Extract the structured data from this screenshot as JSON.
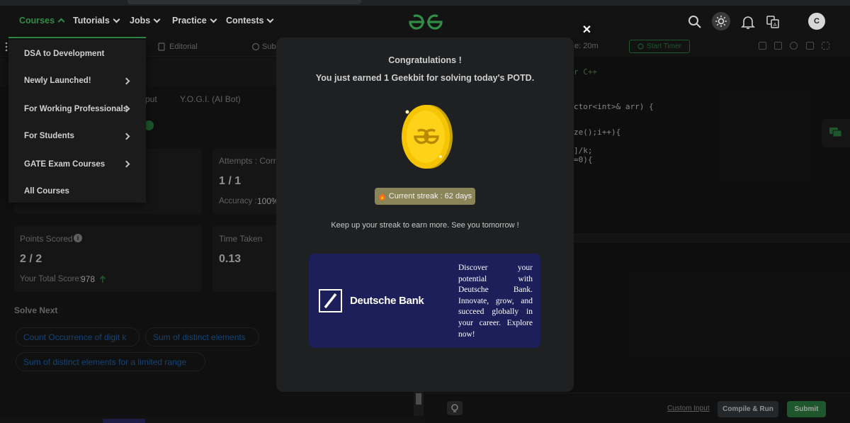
{
  "nav": {
    "items": [
      {
        "label": "Courses"
      },
      {
        "label": "Tutorials"
      },
      {
        "label": "Jobs"
      },
      {
        "label": "Practice"
      },
      {
        "label": "Contests"
      }
    ],
    "avatar_initial": "C",
    "accent": "#2f8d46"
  },
  "courses_menu": {
    "items": [
      {
        "label": "DSA to Development",
        "has_submenu": false
      },
      {
        "label": "Newly Launched!",
        "has_submenu": true
      },
      {
        "label": "For Working Professionals",
        "has_submenu": true
      },
      {
        "label": "For Students",
        "has_submenu": true
      },
      {
        "label": "GATE Exam Courses",
        "has_submenu": true
      },
      {
        "label": "All Courses",
        "has_submenu": false
      }
    ]
  },
  "problem_tabs": {
    "editorial": "Editorial",
    "submissions": "Subm",
    "output_partial": "put",
    "yogi": "Y.O.G.I. (AI Bot)"
  },
  "stats": {
    "attempts_label": "Attempts : Corre",
    "attempts_value": "1 / 1",
    "accuracy_label": "Accuracy :",
    "accuracy_value": "100%",
    "points_label": "Points Scored",
    "points_value": "2 / 2",
    "total_score_label": "Your Total Score:",
    "total_score_value": "978",
    "time_label": "Time Taken",
    "time_value": "0.13"
  },
  "solve_next": {
    "heading": "Solve Next",
    "problems": [
      "Count Occurrence of digit k",
      "Sum of distinct elements",
      "Sum of distinct elements for a limited range"
    ]
  },
  "editor": {
    "time_text": "e: 20m",
    "start_timer": "Start Timer",
    "code_lines": [
      "r C++",
      "ctor<int>& arr) {",
      "ze();i++){",
      "]/k;",
      "=0){"
    ],
    "custom_input": "Custom Input",
    "compile_run": "Compile & Run",
    "submit": "Submit"
  },
  "modal": {
    "title": "Congratulations !",
    "message": "You just earned 1 Geekbit for solving today's POTD.",
    "streak": "Current streak : 62 days",
    "footer": "Keep up your streak to earn more. See you tomorrow !",
    "close_icon": "close-icon"
  },
  "ad": {
    "brand": "Deutsche Bank",
    "copy": "Discover your potential with Deutsche Bank. Innovate, grow, and succeed globally in your career. Explore now!",
    "background": "#1c1f5a"
  }
}
